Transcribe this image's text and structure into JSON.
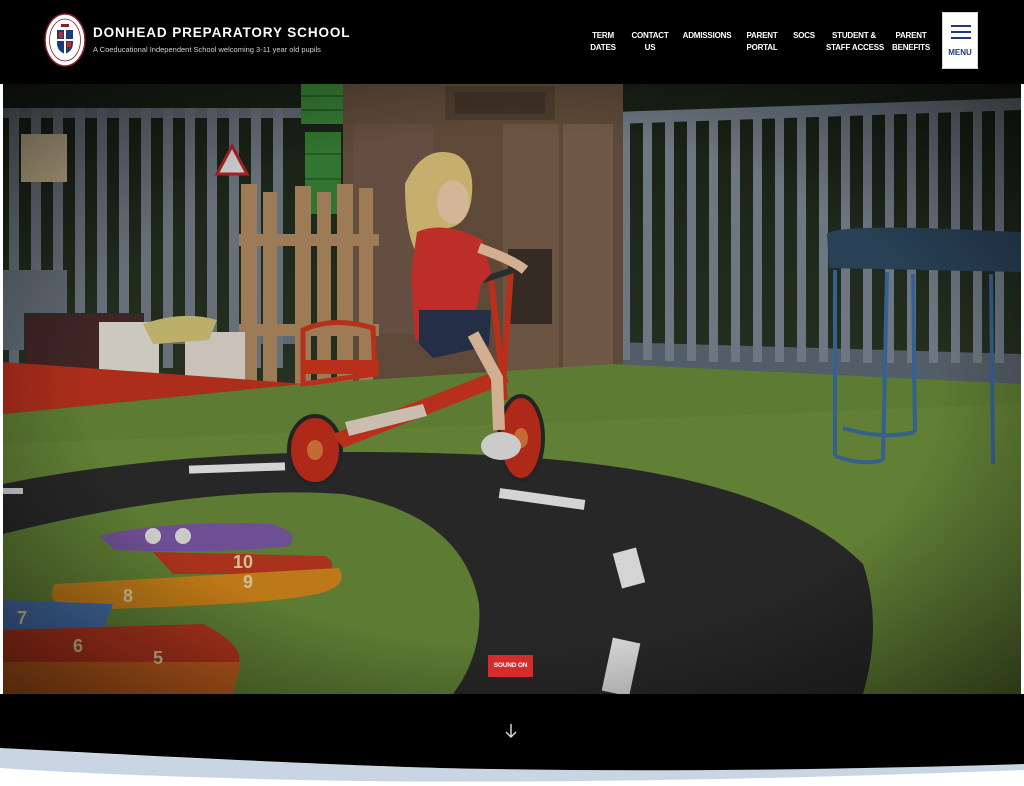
{
  "header": {
    "school_name": "DONHEAD PREPARATORY SCHOOL",
    "tagline": "A Coeducational Independent School welcoming 3-11 year old pupils",
    "crest_icon": "school-crest-icon"
  },
  "nav": {
    "term_dates": [
      "TERM",
      "DATES"
    ],
    "contact_us": [
      "CONTACT",
      "US"
    ],
    "admissions": [
      "ADMISSIONS"
    ],
    "parent_portal": [
      "PARENT",
      "PORTAL"
    ],
    "socs": [
      "SOCS"
    ],
    "student_staff_access": [
      "STUDENT &",
      "STAFF ACCESS"
    ],
    "parent_benefits": [
      "PARENT",
      "BENEFITS"
    ]
  },
  "menu": {
    "label": "MENU",
    "icon": "hamburger-icon"
  },
  "hero": {
    "sound_button": "SOUND ON",
    "playground_numbers": [
      "10",
      "9",
      "8",
      "7",
      "6",
      "5"
    ]
  },
  "scroll": {
    "icon": "arrow-down-icon"
  },
  "colors": {
    "header_bg": "#000000",
    "nav_text": "#ffffff",
    "menu_accent": "#1f3b73",
    "sound_button": "#d52b2b",
    "lower_band_light": "#c9d5e2"
  }
}
